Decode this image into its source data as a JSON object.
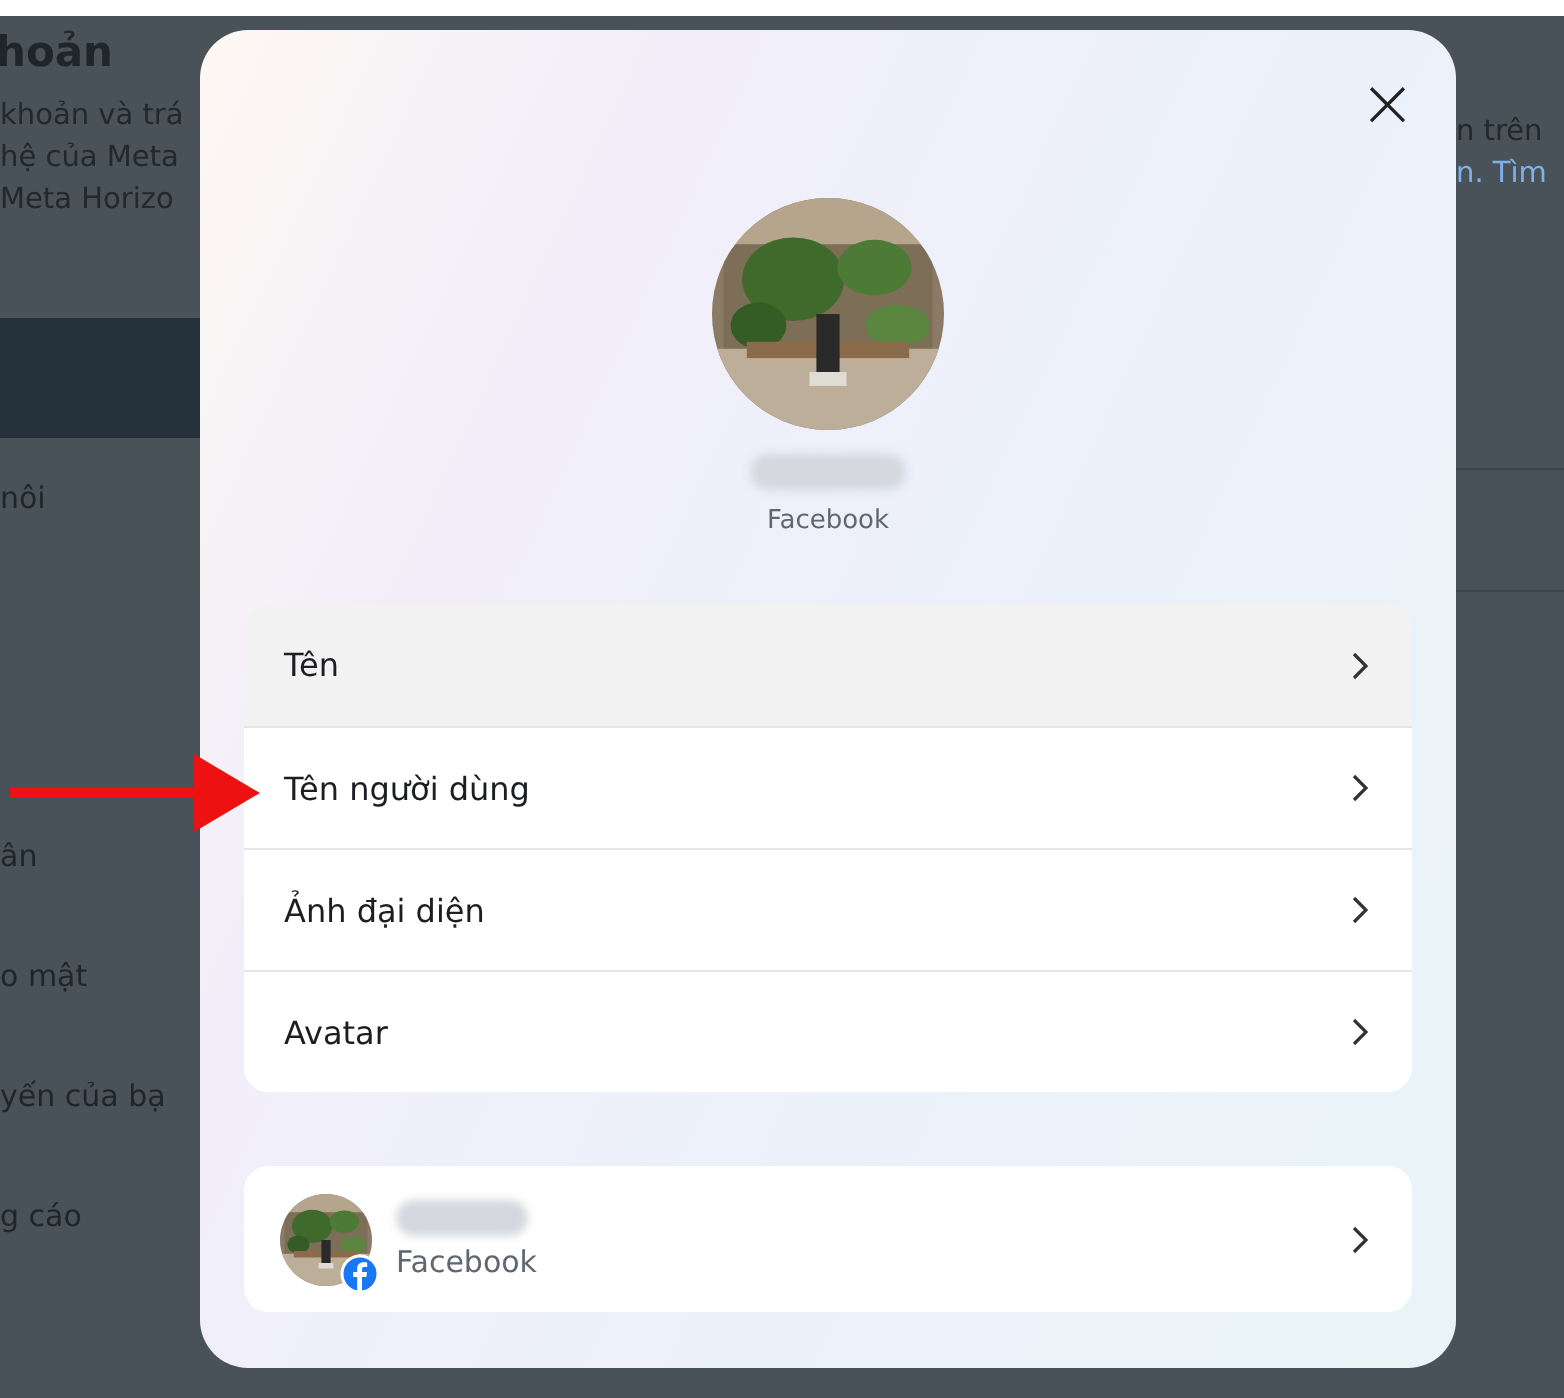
{
  "background_page": {
    "title": "hoản",
    "description_left": [
      "khoản và trá",
      "hệ của Meta",
      "Meta Horizo"
    ],
    "description_right": [
      "n trên"
    ],
    "link_right": "n. Tìm",
    "nav_items": [
      {
        "label": "nôi"
      },
      {
        "label": "ân"
      },
      {
        "label": "o mật"
      },
      {
        "label": "yến của bạ"
      },
      {
        "label": "g cáo"
      }
    ]
  },
  "dialog": {
    "close": "×",
    "profile": {
      "platform": "Facebook"
    },
    "menu": [
      {
        "label": "Tên",
        "highlighted": true
      },
      {
        "label": "Tên người dùng",
        "highlighted": false
      },
      {
        "label": "Ảnh đại diện",
        "highlighted": false
      },
      {
        "label": "Avatar",
        "highlighted": false
      }
    ],
    "accounts": [
      {
        "platform": "Facebook"
      }
    ]
  }
}
